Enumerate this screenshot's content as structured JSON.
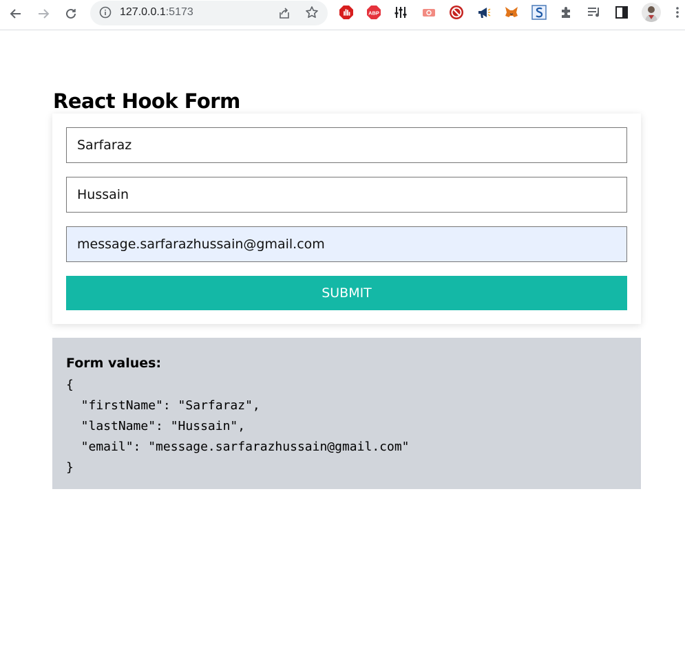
{
  "browser": {
    "url_host": "127.0.0.1",
    "url_port": ":5173",
    "extensions": [
      "adblock-icon",
      "abp-icon",
      "equalizer-icon",
      "ticket-icon",
      "block-icon",
      "megaphone-icon",
      "metamask-icon",
      "s-icon",
      "puzzle-icon",
      "reading-list-icon",
      "side-panel-icon",
      "avatar"
    ],
    "abp_label": "ABP"
  },
  "page": {
    "title": "React Hook Form"
  },
  "form": {
    "first_name": "Sarfaraz",
    "last_name": "Hussain",
    "email": "message.sarfarazhussain@gmail.com",
    "submit_label": "SUBMIT"
  },
  "values": {
    "label": "Form values:",
    "json": "{\n  \"firstName\": \"Sarfaraz\",\n  \"lastName\": \"Hussain\",\n  \"email\": \"message.sarfarazhussain@gmail.com\"\n}"
  },
  "colors": {
    "accent": "#14b8a6",
    "values_bg": "#d1d5db",
    "autofill_bg": "#e8f0fe"
  }
}
